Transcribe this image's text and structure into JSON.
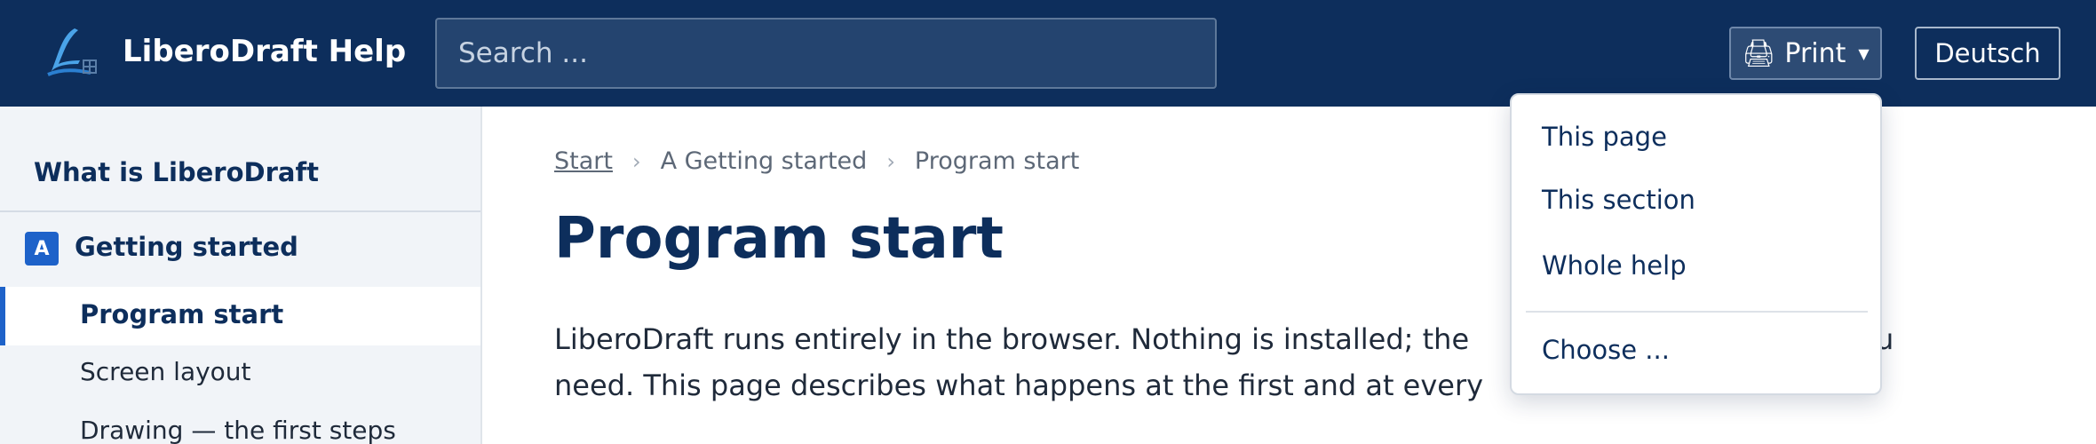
{
  "header": {
    "brand": "LiberoDraft Help",
    "search_placeholder": "Search ...",
    "print_label": "Print",
    "language_label": "Deutsch"
  },
  "sidebar": {
    "top_item": "What is LiberoDraft",
    "section_badge": "A",
    "section_label": "Getting started",
    "active_item": "Program start",
    "items": [
      "Screen layout",
      "Drawing — the first steps"
    ]
  },
  "breadcrumb": [
    "Start",
    "A Getting started",
    "Program start"
  ],
  "page": {
    "title": "Program start",
    "paragraph_line1": "LiberoDraft runs entirely in the browser. Nothing is installed; the",
    "paragraph_line1_end": "u",
    "paragraph_line2": "need. This page describes what happens at the first and at every"
  },
  "print_menu": {
    "items": [
      "This page",
      "This section",
      "Whole help"
    ],
    "choose_label": "Choose ..."
  },
  "colors": {
    "header_bg": "#0d2e5c",
    "accent": "#1e62c9",
    "sidebar_bg": "#f1f4f8"
  },
  "icons": {
    "print": "printer-icon",
    "caret": "caret-down-icon",
    "logo": "liberodraft-logo"
  }
}
